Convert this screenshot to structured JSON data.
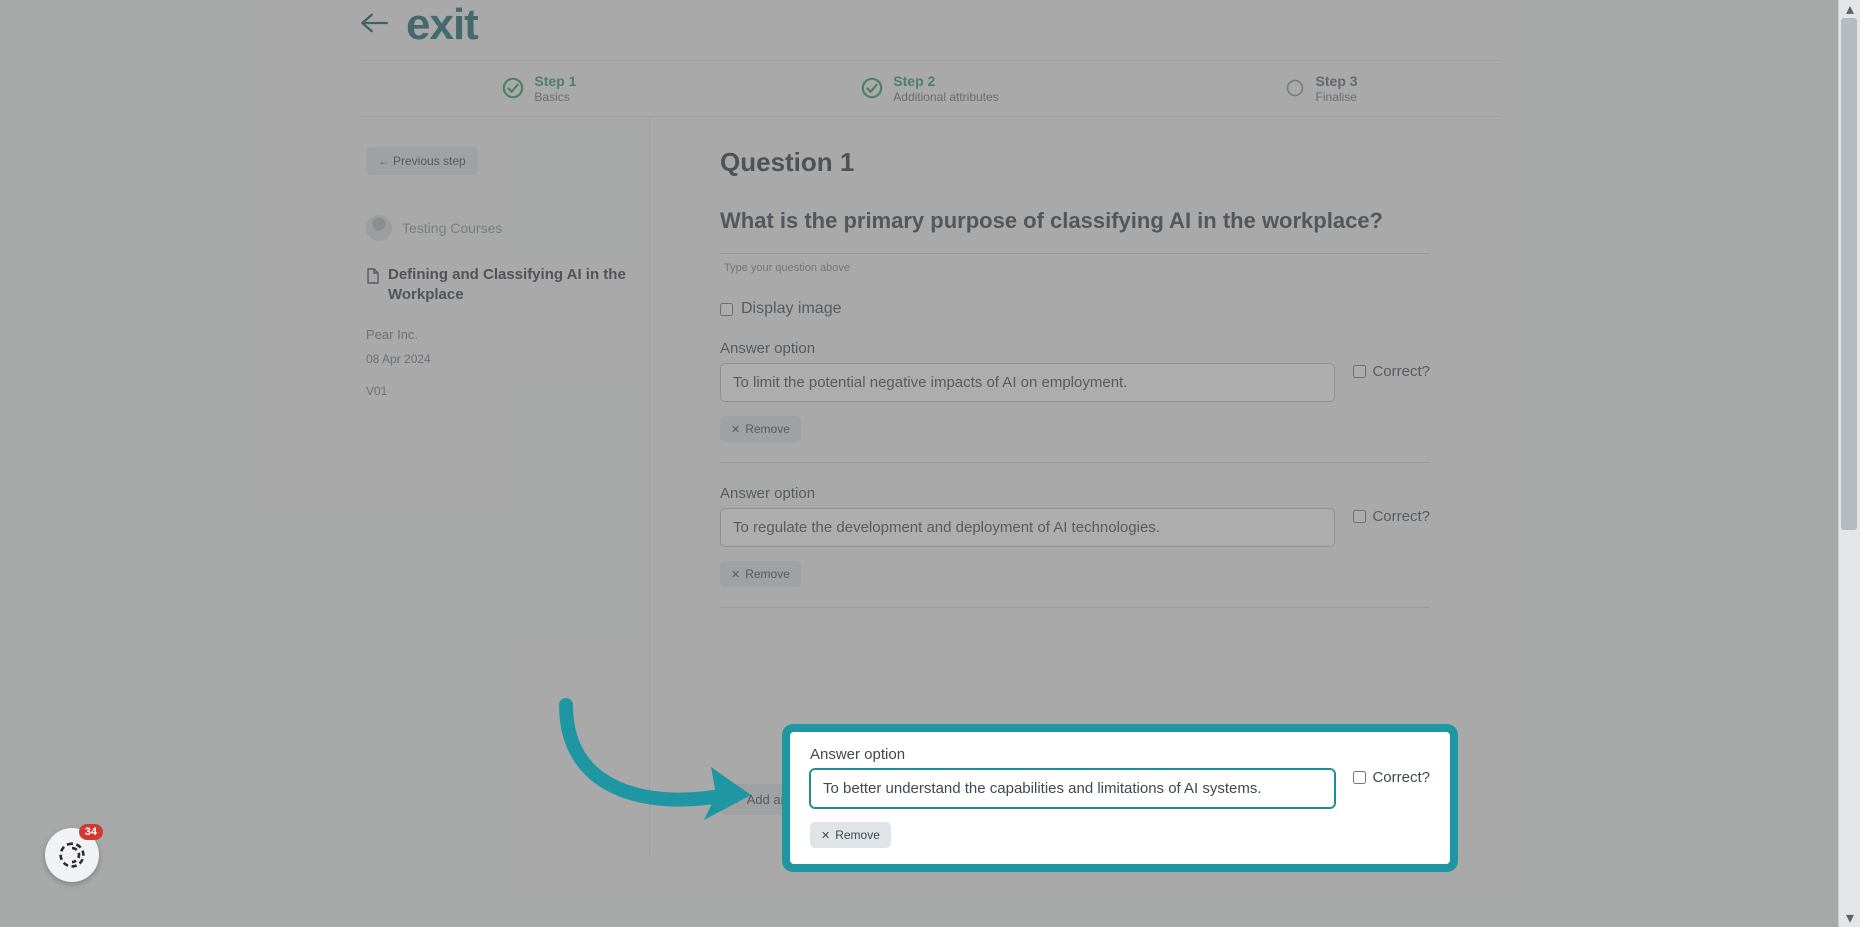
{
  "brand": {
    "logo_text": "exit"
  },
  "stepper": {
    "items": [
      {
        "title": "Step 1",
        "sub": "Basics",
        "state": "done"
      },
      {
        "title": "Step 2",
        "sub": "Additional attributes",
        "state": "done"
      },
      {
        "title": "Step 3",
        "sub": "Finalise",
        "state": "pending"
      }
    ]
  },
  "sidebar": {
    "prev_step_label": "Previous step",
    "author": "Testing Courses",
    "doc_title": "Defining and Classifying AI in the Workplace",
    "company": "Pear Inc.",
    "date": "08 Apr 2024",
    "version": "V01"
  },
  "main": {
    "heading": "Question 1",
    "question_text": "What is the primary purpose of classifying AI in the workplace?",
    "question_helper": "Type your question above",
    "display_image_label": "Display image",
    "display_image_checked": false,
    "answer_label": "Answer option",
    "correct_label": "Correct?",
    "remove_label": "Remove",
    "add_label": "Add another answer option",
    "answers": [
      {
        "value": "To limit the potential negative impacts of AI on employment.",
        "correct": false
      },
      {
        "value": "To regulate the development and deployment of AI technologies.",
        "correct": false
      },
      {
        "value": "To better understand the capabilities and limitations of AI systems.",
        "correct": false
      }
    ]
  },
  "widget": {
    "badge_count": "34"
  },
  "colors": {
    "accent": "#1f97a3",
    "step_active": "#2a9b62",
    "text": "#3e4a52"
  }
}
